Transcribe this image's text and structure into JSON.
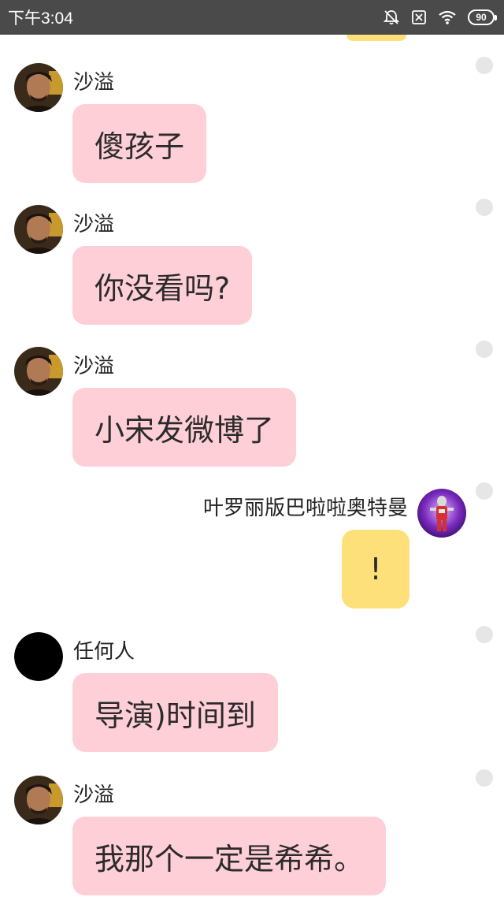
{
  "status_bar": {
    "time": "下午3:04",
    "battery": "90",
    "icons": [
      "bell-off-icon",
      "sim-x-icon",
      "wifi-icon",
      "battery-icon"
    ]
  },
  "messages": [
    {
      "sender": "沙溢",
      "text": "傻孩子",
      "side": "left",
      "avatar": "shayi-avatar"
    },
    {
      "sender": "沙溢",
      "text": "你没看吗?",
      "side": "left",
      "avatar": "shayi-avatar"
    },
    {
      "sender": "沙溢",
      "text": "小宋发微博了",
      "side": "left",
      "avatar": "shayi-avatar"
    },
    {
      "sender": "叶罗丽版巴啦啦奥特曼",
      "text": "!",
      "side": "right",
      "avatar": "ultraman-avatar"
    },
    {
      "sender": "任何人",
      "text": "导演)时间到",
      "side": "left",
      "avatar": "black-avatar"
    },
    {
      "sender": "沙溢",
      "text": "我那个一定是希希。",
      "side": "left",
      "avatar": "shayi-avatar"
    }
  ],
  "colors": {
    "status_bar_bg": "#4a4a4a",
    "incoming_bubble": "#ffcfd8",
    "outgoing_bubble": "#fde07a",
    "unread_dot": "#e6e6e6"
  }
}
